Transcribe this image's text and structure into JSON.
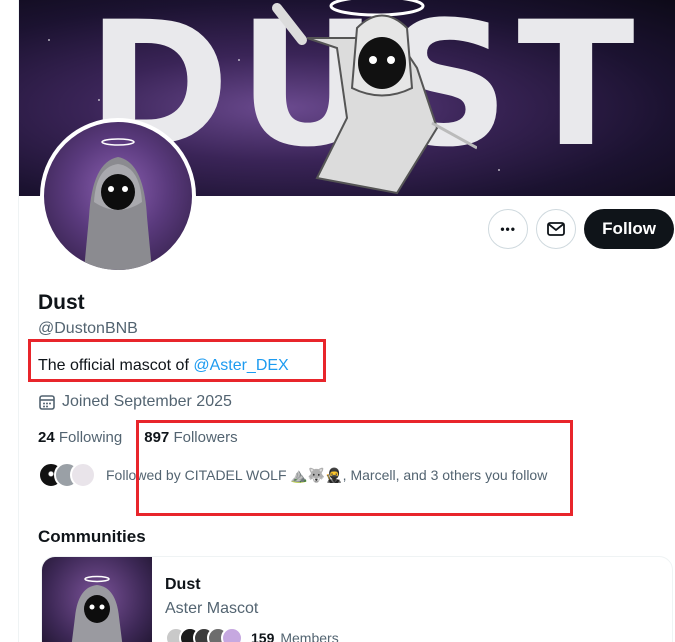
{
  "banner": {
    "wordmark": "DUST"
  },
  "actions": {
    "more_label": "•••",
    "follow_label": "Follow"
  },
  "profile": {
    "name": "Dust",
    "handle": "@DustonBNB",
    "bio_prefix": "The official mascot of ",
    "bio_mention": "@Aster_DEX",
    "joined": "Joined September 2025",
    "following_count": "24",
    "following_label": "Following",
    "followers_count": "897",
    "followers_label": "Followers",
    "followed_by": "Followed by CITADEL WOLF ⛰️🐺🥷, Marcell, and 3 others you follow"
  },
  "communities": {
    "title": "Communities",
    "items": [
      {
        "name": "Dust",
        "subtitle": "Aster Mascot",
        "members_count": "159",
        "members_label": "Members"
      }
    ]
  },
  "colors": {
    "accent": "#1d9bf0",
    "text_primary": "#0f1419",
    "text_secondary": "#536471",
    "annotation": "#e8252b"
  }
}
